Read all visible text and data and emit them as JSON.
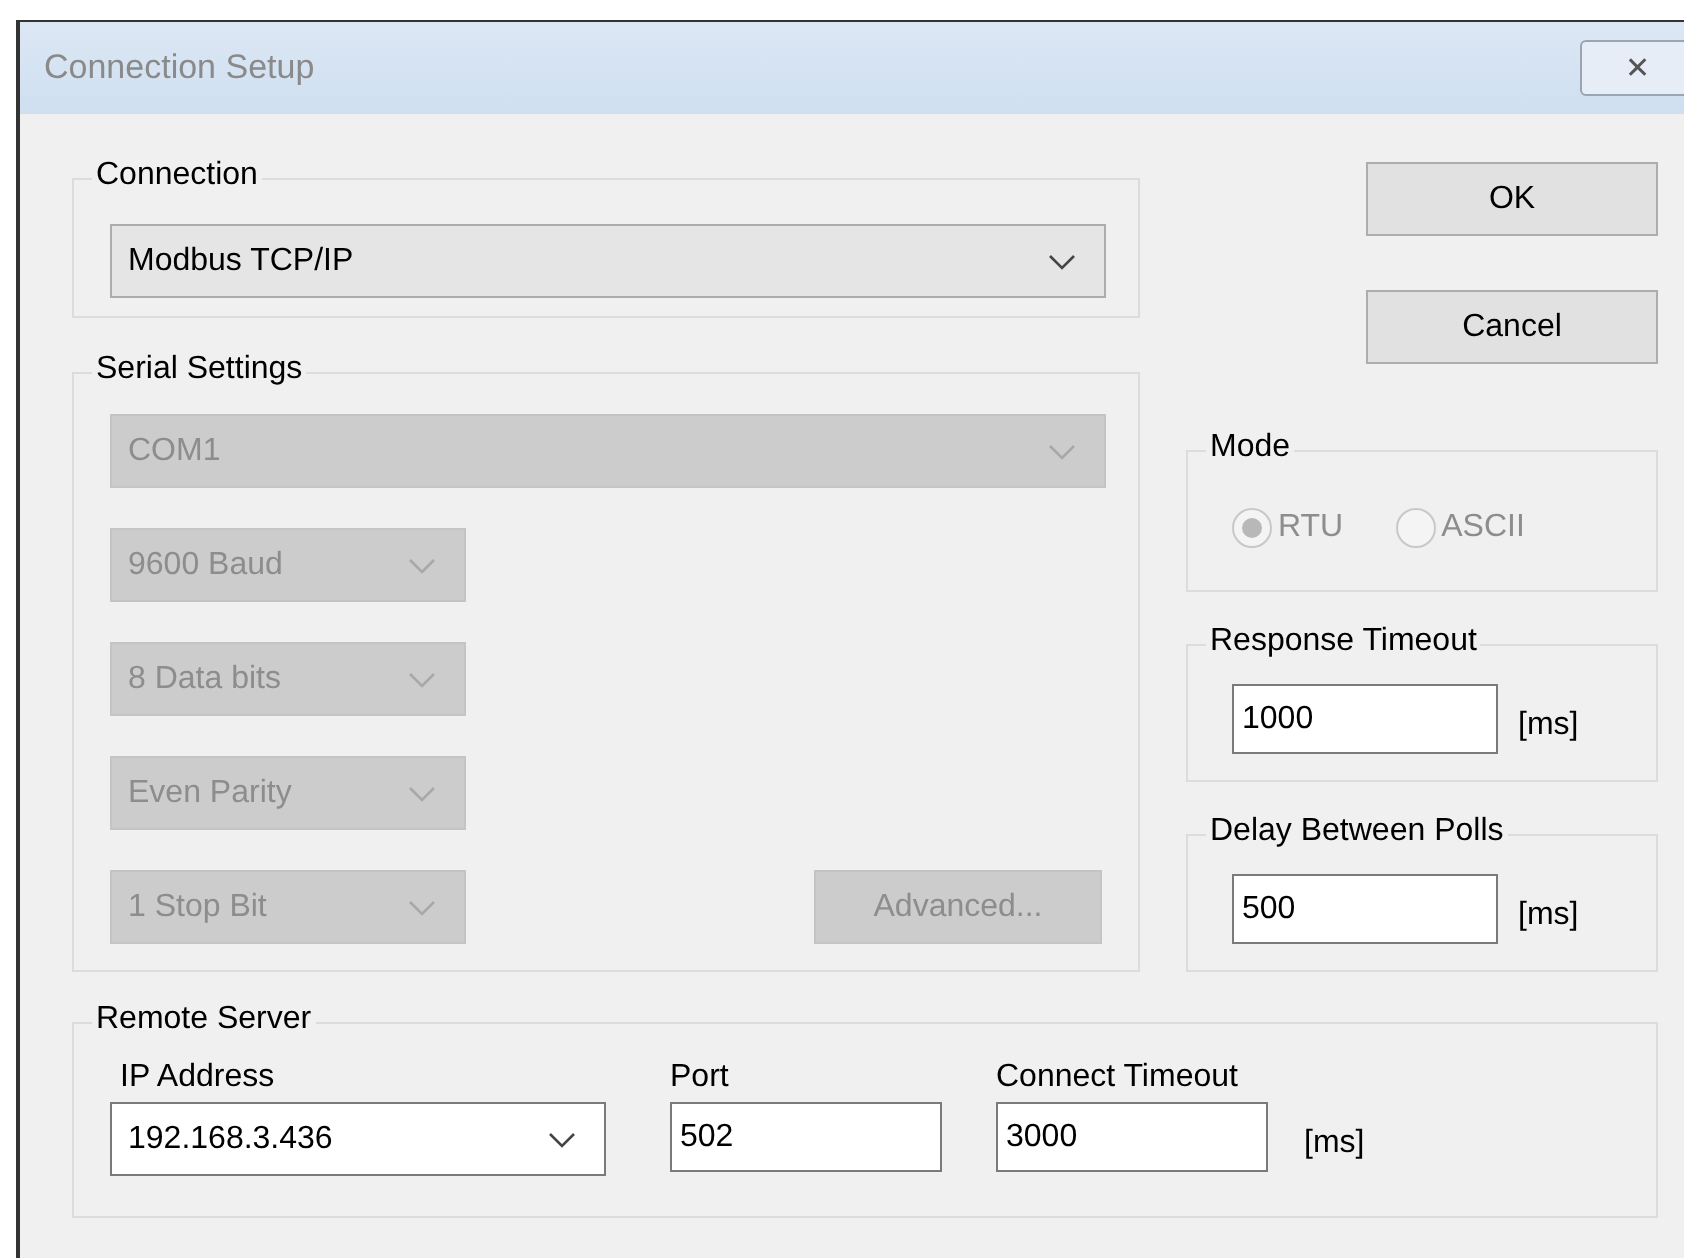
{
  "window": {
    "title": "Connection Setup",
    "close": "✕"
  },
  "connection": {
    "label": "Connection",
    "value": "Modbus TCP/IP"
  },
  "serial": {
    "label": "Serial Settings",
    "disabled": true,
    "port": "COM1",
    "options": [
      "9600 Baud",
      "8 Data bits",
      "Even Parity",
      "1 Stop Bit"
    ],
    "advanced_button": "Advanced..."
  },
  "buttons": [
    "OK",
    "Cancel"
  ],
  "mode": {
    "label": "Mode",
    "disabled": true,
    "options": [
      {
        "label": "RTU",
        "selected": true
      },
      {
        "label": "ASCII",
        "selected": false
      }
    ]
  },
  "timeouts": [
    {
      "label": "Response Timeout",
      "value": "1000",
      "unit": "[ms]"
    },
    {
      "label": "Delay Between Polls",
      "value": "500",
      "unit": "[ms]"
    }
  ],
  "remote_server": {
    "label": "Remote Server",
    "ip": {
      "label": "IP Address",
      "value": "192.168.3.436"
    },
    "port": {
      "label": "Port",
      "value": "502"
    },
    "connect_timeout": {
      "label": "Connect Timeout",
      "value": "3000",
      "unit": "[ms]"
    }
  }
}
